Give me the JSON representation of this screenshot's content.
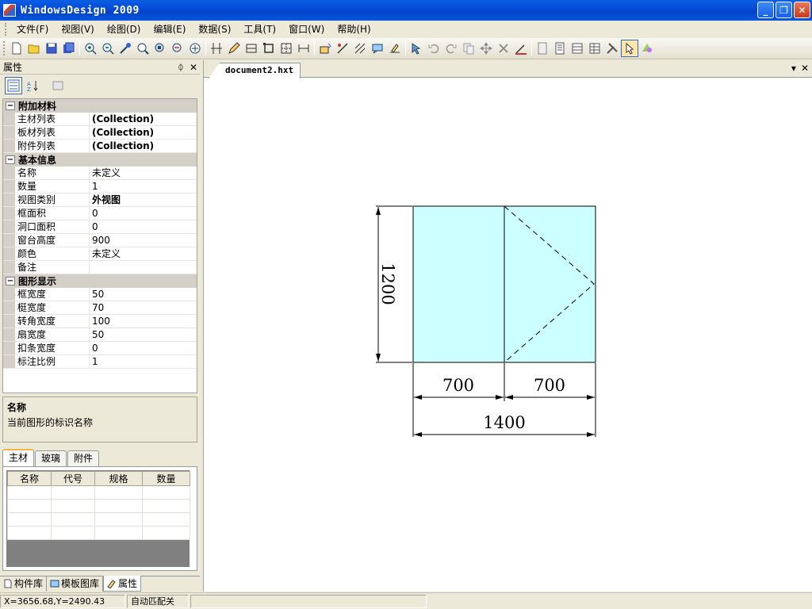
{
  "window": {
    "title": "WindowsDesign 2009"
  },
  "menu": [
    "文件(F)",
    "视图(V)",
    "绘图(D)",
    "编辑(E)",
    "数据(S)",
    "工具(T)",
    "窗口(W)",
    "帮助(H)"
  ],
  "panel": {
    "title": "属性",
    "categories": [
      {
        "name": "附加材料",
        "rows": [
          {
            "name": "主材列表",
            "value": "(Collection)"
          },
          {
            "name": "板材列表",
            "value": "(Collection)"
          },
          {
            "name": "附件列表",
            "value": "(Collection)"
          }
        ]
      },
      {
        "name": "基本信息",
        "rows": [
          {
            "name": "名称",
            "value": "未定义"
          },
          {
            "name": "数量",
            "value": "1"
          },
          {
            "name": "视图类别",
            "value": "外视图"
          },
          {
            "name": "框面积",
            "value": "0"
          },
          {
            "name": "洞口面积",
            "value": "0"
          },
          {
            "name": "窗台高度",
            "value": "900"
          },
          {
            "name": "颜色",
            "value": "未定义"
          },
          {
            "name": "备注",
            "value": ""
          }
        ]
      },
      {
        "name": "图形显示",
        "rows": [
          {
            "name": "框宽度",
            "value": "50"
          },
          {
            "name": "梃宽度",
            "value": "70"
          },
          {
            "name": "转角宽度",
            "value": "100"
          },
          {
            "name": "扇宽度",
            "value": "50"
          },
          {
            "name": "扣条宽度",
            "value": "0"
          },
          {
            "name": "标注比例",
            "value": "1"
          }
        ]
      }
    ],
    "description": {
      "title": "名称",
      "text": "当前图形的标识名称"
    },
    "subtabs": [
      "主材",
      "玻璃",
      "附件"
    ],
    "table_headers": [
      "名称",
      "代号",
      "规格",
      "数量"
    ],
    "bottom_tabs": [
      "构件库",
      "模板图库",
      "属性"
    ]
  },
  "document": {
    "tab": "document2.hxt",
    "drawing": {
      "fill": "#ccffff",
      "dim_left": "700",
      "dim_right": "700",
      "dim_total": "1400",
      "dim_height": "1200"
    }
  },
  "status": {
    "coords": "X=3656.68,Y=2490.43",
    "mode": "自动匹配关",
    "empty": ""
  }
}
